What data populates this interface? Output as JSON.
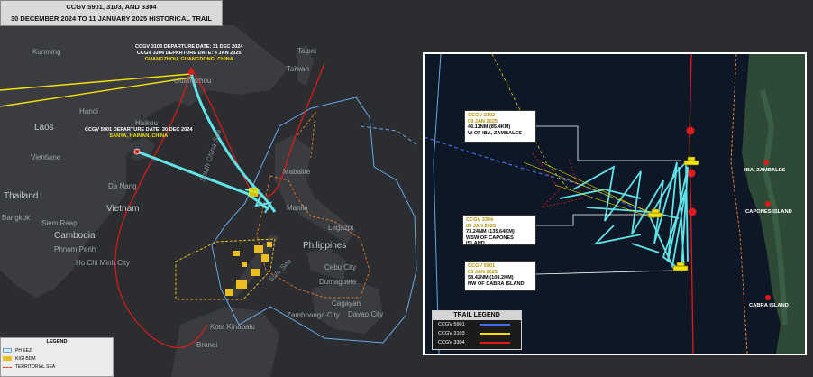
{
  "title": {
    "line1": "CCGV 5901, 3103, AND 3304",
    "line2": "30 DECEMBER 2024  TO 11 JANUARY 2025 HISTORICAL TRAIL"
  },
  "places": {
    "kunming": "Kunming",
    "taipei": "Taipei",
    "taiwan": "Taiwan",
    "guangzhou": "Guangzhou",
    "hanoi": "Hanoi",
    "haikou": "Haikou",
    "laos": "Laos",
    "vientiane": "Vientiane",
    "da_nang": "Da Nang",
    "thailand": "Thailand",
    "bangkok": "Bangkok",
    "vietnam": "Vietnam",
    "siem_reap": "Siem Reap",
    "cambodia": "Cambodia",
    "phnom_penh": "Phnom Penh",
    "ho_chi_minh": "Ho Chi Minh City",
    "south_china_sea": "South China Sea",
    "mabalite": "Mabalite",
    "manila": "Manila",
    "legazpi": "Legazpi",
    "philippines": "Philippines",
    "cebu_city": "Cebu City",
    "dumaguete": "Dumaguete",
    "sulu_sea": "Sulu Sea",
    "cagayan": "Cagayan",
    "zamboanga": "Zamboanga City",
    "davao": "Davao City",
    "kota_kinabalu": "Kota Kinabalu",
    "brunei": "Brunei"
  },
  "departures": {
    "guangzhou_l1": "CCGV 3103 DEPARTURE DATE: 31 DEC  2024",
    "guangzhou_l2": "CCGV 3304  DEPARTURE DATE:  4 JAN 2025",
    "guangzhou_l3": "GUANGZHOU, GUANGDONG, CHINA",
    "sanya_l1": "CCGV 5901 DEPARTURE DATE: 30 DEC 2024",
    "sanya_l2": "SANYA, HAINAN, CHINA"
  },
  "callouts": [
    {
      "vessel": "CCGV 3103",
      "date": "09 JAN 2025",
      "distance": "46.11NM (85.4KM)",
      "location": "W OF IBA, ZAMBALES"
    },
    {
      "vessel": "CCGV 3304",
      "date": "09 JAN 2025",
      "distance": "73.24NM (135.64KM)",
      "location": "WSW OF CAPONES ISLAND"
    },
    {
      "vessel": "CCGV 5901",
      "date": "03 JAN 2025",
      "distance": "58.42NM (108.2KM)",
      "location": "NW OF CABRA ISLAND"
    }
  ],
  "inset_places": {
    "iba": "IBA, ZAMBALES",
    "capones": "CAPONES ISLAND",
    "cabra": "CABRA ISLAND"
  },
  "trail_legend": {
    "title": "TRAIL LEGEND",
    "items": [
      {
        "label": "CCGV 5901",
        "color": "#3f6fe8"
      },
      {
        "label": "CCGV 3103",
        "color": "#f2e200"
      },
      {
        "label": "CCGV 3304",
        "color": "#e01919"
      }
    ]
  },
  "legend": {
    "title": "LEGEND",
    "items": [
      {
        "label": "PH EEZ",
        "color": "#6aa6e8"
      },
      {
        "label": "KIGI BDM",
        "color": "#e8c020"
      },
      {
        "label": "TERRITORIAL SEA",
        "color": "#e0401a"
      }
    ]
  },
  "colors": {
    "trail_cyan": "#5fe3e8",
    "land": "#3b3d40",
    "sea": "#2b2d30",
    "eez": "#6aa6e8",
    "kigi": "#e8c020",
    "ts": "#e07a2a"
  }
}
